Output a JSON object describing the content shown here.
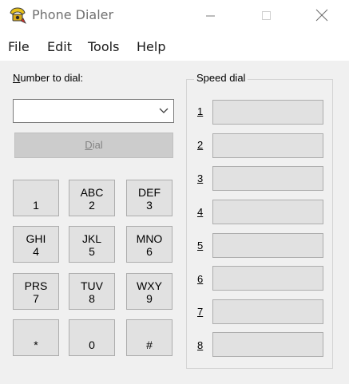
{
  "window": {
    "title": "Phone Dialer",
    "icon": "phone-dialer-app-icon"
  },
  "menu": [
    {
      "label": "File"
    },
    {
      "label": "Edit"
    },
    {
      "label": "Tools"
    },
    {
      "label": "Help"
    }
  ],
  "dialer": {
    "number_label_underlined": "N",
    "number_label_rest": "umber to dial:",
    "number_value": "",
    "dial_button_underlined": "D",
    "dial_button_rest": "ial"
  },
  "keypad": [
    {
      "letters": "",
      "digit": "1"
    },
    {
      "letters": "ABC",
      "digit": "2"
    },
    {
      "letters": "DEF",
      "digit": "3"
    },
    {
      "letters": "GHI",
      "digit": "4"
    },
    {
      "letters": "JKL",
      "digit": "5"
    },
    {
      "letters": "MNO",
      "digit": "6"
    },
    {
      "letters": "PRS",
      "digit": "7"
    },
    {
      "letters": "TUV",
      "digit": "8"
    },
    {
      "letters": "WXY",
      "digit": "9"
    },
    {
      "letters": "",
      "digit": "*"
    },
    {
      "letters": "",
      "digit": "0"
    },
    {
      "letters": "",
      "digit": "#"
    }
  ],
  "speed_dial": {
    "title": "Speed dial",
    "slots": [
      {
        "label": "1",
        "value": ""
      },
      {
        "label": "2",
        "value": ""
      },
      {
        "label": "3",
        "value": ""
      },
      {
        "label": "4",
        "value": ""
      },
      {
        "label": "5",
        "value": ""
      },
      {
        "label": "6",
        "value": ""
      },
      {
        "label": "7",
        "value": ""
      },
      {
        "label": "8",
        "value": ""
      }
    ]
  }
}
